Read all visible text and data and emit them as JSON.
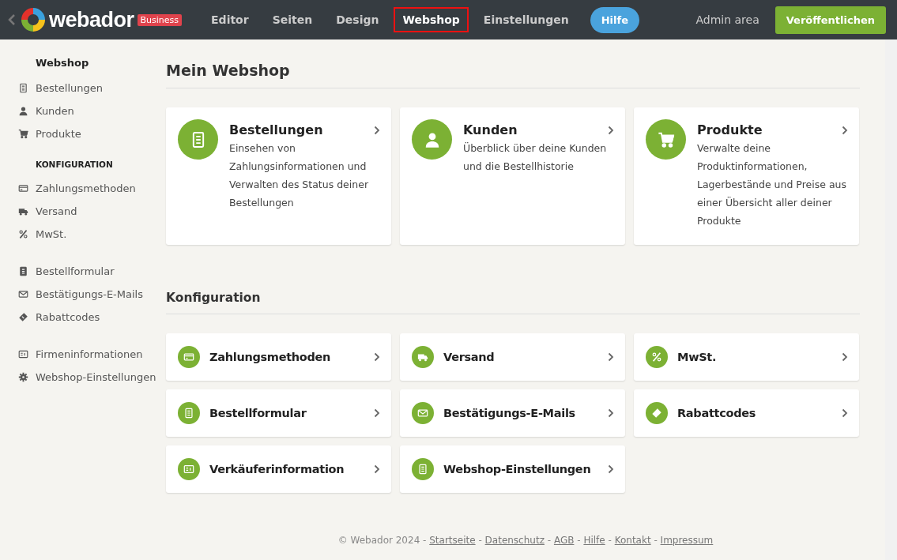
{
  "topbar": {
    "logo_text": "webador",
    "plan_badge": "Business",
    "nav": [
      {
        "label": "Editor",
        "kind": "tab",
        "selected": false
      },
      {
        "label": "Seiten",
        "kind": "tab",
        "selected": false
      },
      {
        "label": "Design",
        "kind": "tab",
        "selected": false
      },
      {
        "label": "Webshop",
        "kind": "tab",
        "selected": true
      },
      {
        "label": "Einstellungen",
        "kind": "tab",
        "selected": false
      },
      {
        "label": "Hilfe",
        "kind": "pill",
        "selected": false
      }
    ],
    "admin_link": "Admin area",
    "publish_button": "Veröffentlichen"
  },
  "sidebar": {
    "groups": [
      {
        "heading": "Webshop",
        "items": [
          "Bestellungen",
          "Kunden",
          "Produkte"
        ]
      },
      {
        "heading": "KONFIGURATION",
        "items": [
          "Zahlungsmethoden",
          "Versand",
          "MwSt."
        ]
      },
      {
        "items": [
          "Bestellformular",
          "Bestätigungs-E-Mails",
          "Rabattcodes"
        ]
      },
      {
        "items": [
          "Firmeninformationen",
          "Webshop-Einstellungen"
        ]
      }
    ]
  },
  "main": {
    "title": "Mein Webshop",
    "cards": [
      {
        "title": "Bestellungen",
        "description": "Einsehen von Zahlungsinformationen und Verwalten des Status deiner Bestellungen"
      },
      {
        "title": "Kunden",
        "description": "Überblick über deine Kunden und die Bestellhistorie"
      },
      {
        "title": "Produkte",
        "description": "Verwalte deine Produktinformationen, Lagerbestände und Preise aus einer Übersicht aller deiner Produkte"
      }
    ],
    "config_title": "Konfiguration",
    "config_items": [
      "Zahlungsmethoden",
      "Versand",
      "MwSt.",
      "Bestellformular",
      "Bestätigungs-E-Mails",
      "Rabattcodes",
      "Verkäuferinformation",
      "Webshop-Einstellungen"
    ]
  },
  "footer": {
    "copyright": "© Webador 2024",
    "separator": "-",
    "links": [
      "Startseite",
      "Datenschutz",
      "AGB",
      "Hilfe",
      "Kontakt",
      "Impressum"
    ]
  }
}
